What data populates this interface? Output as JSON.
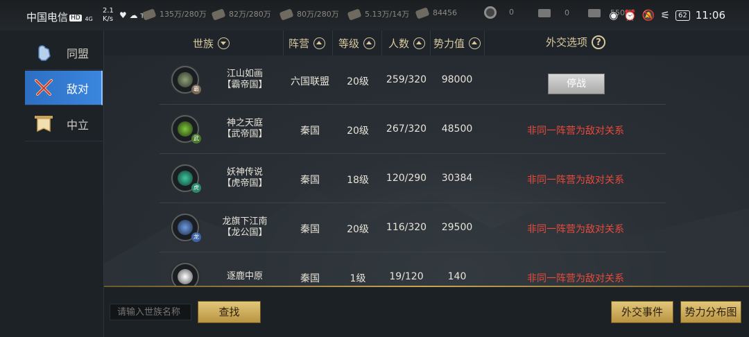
{
  "statusbar": {
    "carrier": "中国电信",
    "hd": "HD",
    "signal": "4G",
    "speed_value": "2.1",
    "speed_unit": "K/s",
    "tap": "Tap",
    "resources": [
      "135万/280万",
      "82万/280万",
      "80万/280万",
      "5.13万/14万",
      "84456"
    ],
    "coins": [
      "0",
      "0",
      "5508"
    ],
    "battery": "62",
    "time": "11:06"
  },
  "sidebar": {
    "items": [
      {
        "label": "同盟",
        "icon": "fist-icon"
      },
      {
        "label": "敌对",
        "icon": "crossed-swords-icon"
      },
      {
        "label": "中立",
        "icon": "banner-icon"
      }
    ],
    "active": "敌对"
  },
  "table": {
    "headers": {
      "clan": "世族",
      "camp": "阵营",
      "level": "等级",
      "members": "人数",
      "power": "势力值",
      "diplomacy": "外交选项"
    },
    "rows": [
      {
        "name": "江山如画",
        "title": "【霸帝国】",
        "camp": "六国联盟",
        "level": "20级",
        "members": "259/320",
        "power": "98000",
        "action": "停战",
        "emblem_color": "#8fa07a",
        "tag_color": "#7a6a55",
        "tag": "霸"
      },
      {
        "name": "神之天庭",
        "title": "【武帝国】",
        "camp": "秦国",
        "level": "20级",
        "members": "267/320",
        "power": "48500",
        "relation": "非同一阵营为敌对关系",
        "emblem_color": "#7ec640",
        "tag_color": "#4a7a2c",
        "tag": "武"
      },
      {
        "name": "妖神传说",
        "title": "【虎帝国】",
        "camp": "秦国",
        "level": "18级",
        "members": "120/290",
        "power": "30384",
        "relation": "非同一阵营为敌对关系",
        "emblem_color": "#3fc7a0",
        "tag_color": "#2b8a6c",
        "tag": "虎"
      },
      {
        "name": "龙旗下江南",
        "title": "【龙公国】",
        "camp": "秦国",
        "level": "20级",
        "members": "116/320",
        "power": "29500",
        "relation": "非同一阵营为敌对关系",
        "emblem_color": "#6e9ce0",
        "tag_color": "#3e64a8",
        "tag": "龙"
      },
      {
        "name": "逐鹿中原",
        "title": "",
        "camp": "秦国",
        "level": "1级",
        "members": "19/120",
        "power": "140",
        "relation": "非同一阵营为敌对关系",
        "emblem_color": "#d8d8d8",
        "tag_color": "",
        "tag": ""
      }
    ]
  },
  "bottom": {
    "search_placeholder": "请输入世族名称",
    "search_button": "查找",
    "events_button": "外交事件",
    "map_button": "势力分布图"
  }
}
